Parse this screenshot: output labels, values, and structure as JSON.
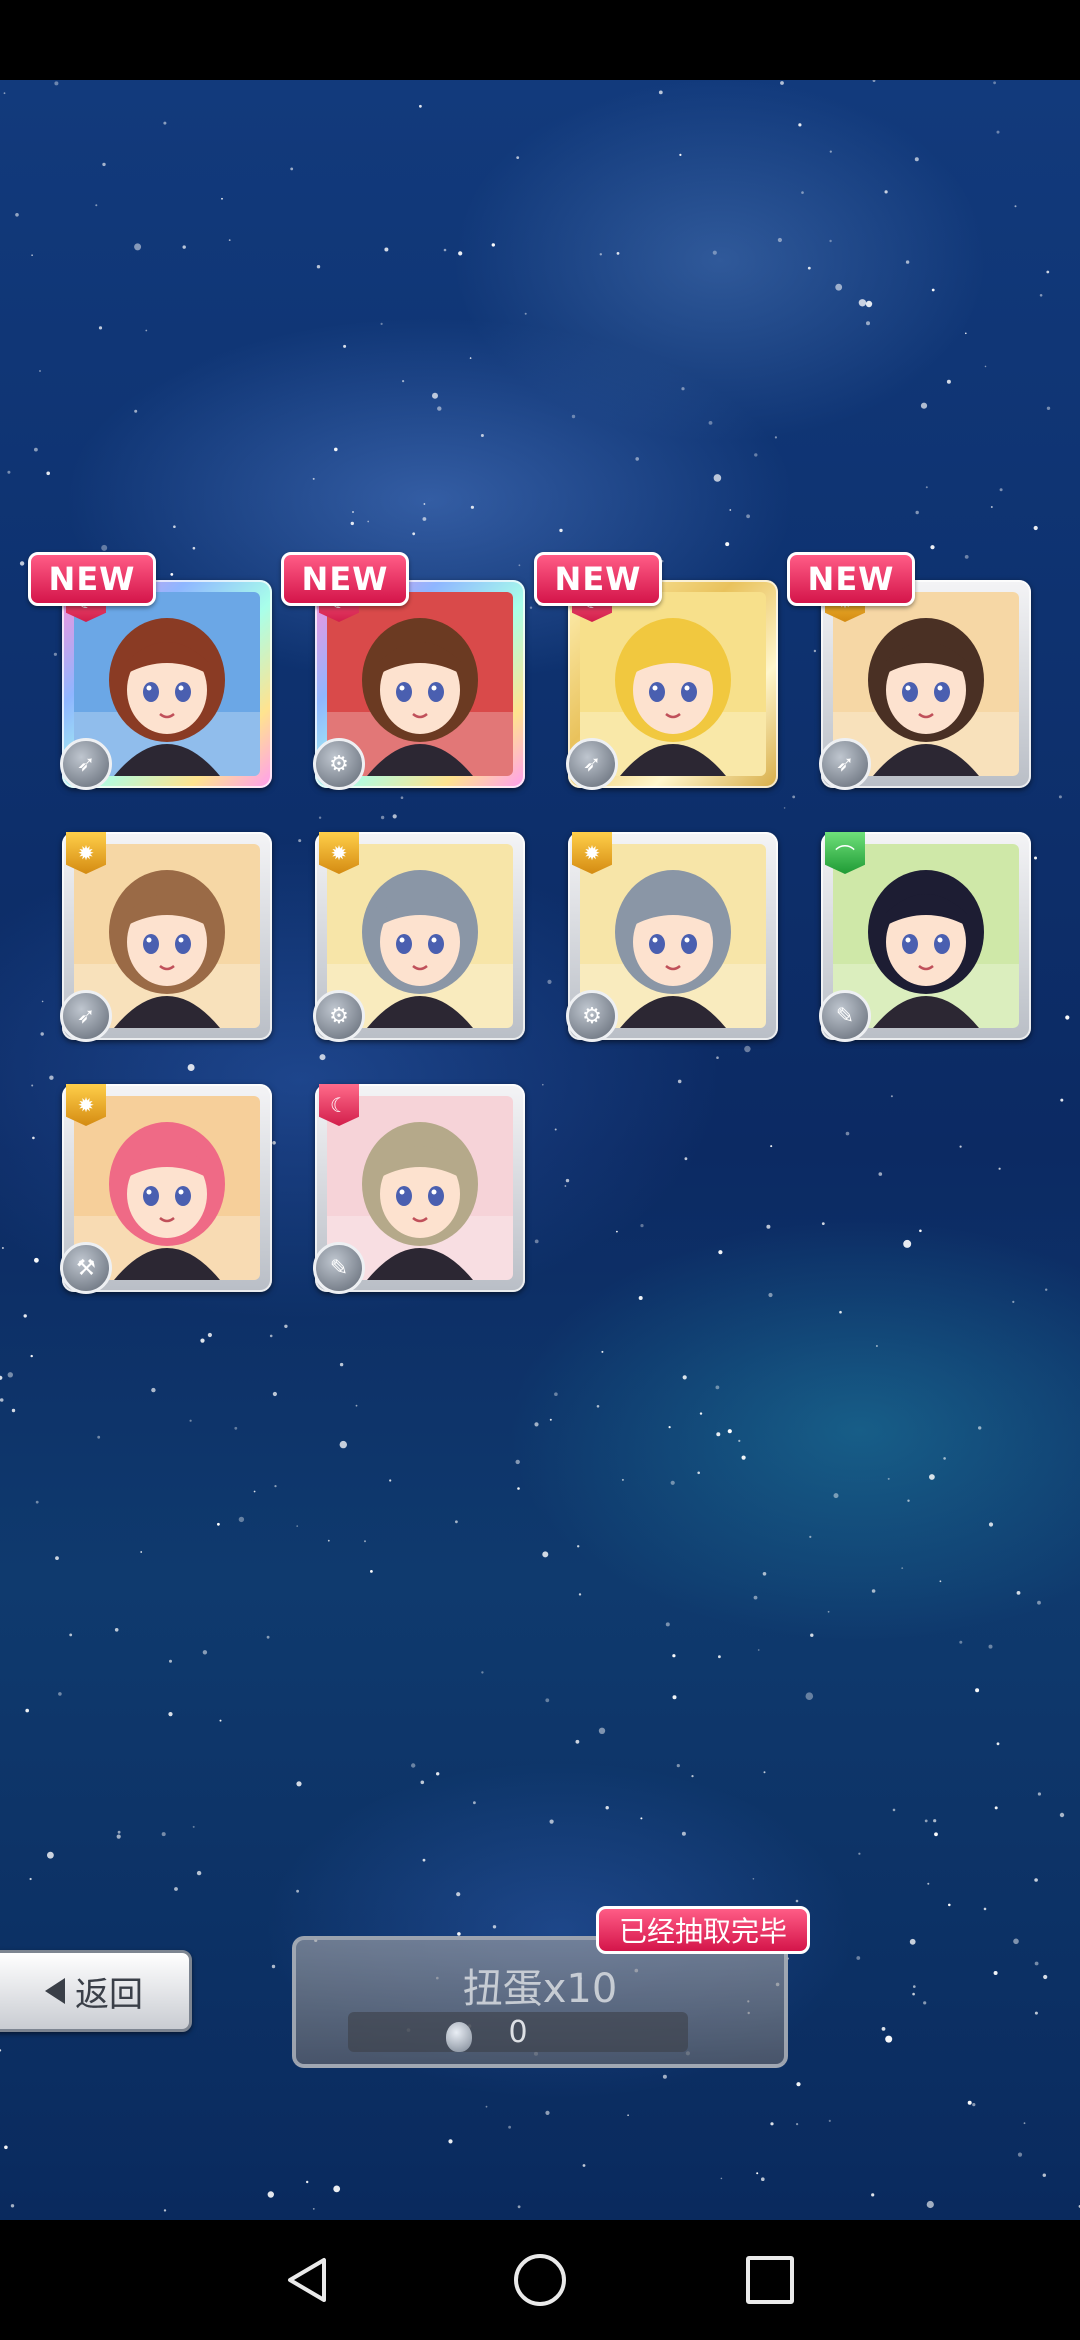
{
  "results": {
    "new_label": "NEW",
    "cards": [
      {
        "id": 1,
        "is_new": true,
        "attribute_icon": "moon-icon",
        "class_icon": "rocket-icon",
        "frame": "rainbow",
        "hair_color": "#8a3b24",
        "bg_color": "#6ba7e6"
      },
      {
        "id": 2,
        "is_new": true,
        "attribute_icon": "moon-icon",
        "class_icon": "gear-icon",
        "frame": "rainbow",
        "hair_color": "#6b3a22",
        "bg_color": "#d94a4a"
      },
      {
        "id": 3,
        "is_new": true,
        "attribute_icon": "moon-icon",
        "class_icon": "rocket-icon",
        "frame": "gold",
        "hair_color": "#f1c83f",
        "bg_color": "#f7e08b"
      },
      {
        "id": 4,
        "is_new": true,
        "attribute_icon": "sun-icon",
        "class_icon": "rocket-icon",
        "frame": "silver",
        "hair_color": "#4a3024",
        "bg_color": "#f6d7a5"
      },
      {
        "id": 5,
        "is_new": false,
        "attribute_icon": "sun-icon",
        "class_icon": "rocket-icon",
        "frame": "silver",
        "hair_color": "#9a6a46",
        "bg_color": "#f6d7a5"
      },
      {
        "id": 6,
        "is_new": false,
        "attribute_icon": "sun-icon",
        "class_icon": "gear-icon",
        "frame": "silver",
        "hair_color": "#8a96a6",
        "bg_color": "#f7e5a8"
      },
      {
        "id": 7,
        "is_new": false,
        "attribute_icon": "sun-icon",
        "class_icon": "gear-icon",
        "frame": "silver",
        "hair_color": "#8a96a6",
        "bg_color": "#f7e5a8"
      },
      {
        "id": 8,
        "is_new": false,
        "attribute_icon": "leaf-icon",
        "class_icon": "wrench-icon",
        "frame": "silver",
        "hair_color": "#1d1d33",
        "bg_color": "#cfe8a8"
      },
      {
        "id": 9,
        "is_new": false,
        "attribute_icon": "sun-icon",
        "class_icon": "hammer-icon",
        "frame": "silver",
        "hair_color": "#ef6a86",
        "bg_color": "#f6cf9a"
      },
      {
        "id": 10,
        "is_new": false,
        "attribute_icon": "moon-icon",
        "class_icon": "wrench-icon",
        "frame": "silver",
        "hair_color": "#b5a98a",
        "bg_color": "#f6d3d8"
      }
    ]
  },
  "footer": {
    "back_label": "返回",
    "gacha_label": "扭蛋x10",
    "gacha_cost": "0",
    "completed_label": "已经抽取完毕"
  },
  "colors": {
    "new_tag": "#e0245e",
    "space_bg": "#0e3270"
  }
}
